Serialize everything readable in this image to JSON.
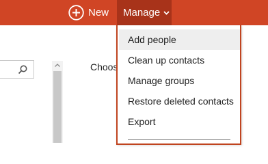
{
  "topbar": {
    "new_label": "New",
    "manage_label": "Manage",
    "accent_color": "#d04525",
    "active_color": "#a8331a"
  },
  "search": {
    "icon": "search-icon"
  },
  "content": {
    "choose_text": "Choos"
  },
  "manage_menu": {
    "items": [
      {
        "label": "Add people",
        "highlighted": true
      },
      {
        "label": "Clean up contacts",
        "highlighted": false
      },
      {
        "label": "Manage groups",
        "highlighted": false
      },
      {
        "label": "Restore deleted contacts",
        "highlighted": false
      },
      {
        "label": "Export",
        "highlighted": false
      }
    ]
  }
}
